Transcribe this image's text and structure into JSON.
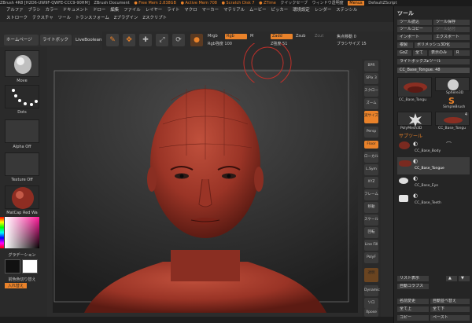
{
  "titlebar": {
    "items": [
      "ZBrush 4R8 [H2D6-UW9F-QWFE-CCC9-90HM]",
      "ZBrush Document",
      "● Free Mem 2.838GB",
      "● Active Mem 708",
      "● Scratch Disk 7",
      "● ZTime",
      "クイックセーブ",
      "ウィンドウ透明度",
      "Menus",
      "DefaultZScript"
    ],
    "highlight": "Menus"
  },
  "menubar": {
    "row1": [
      "アルファ",
      "ブラシ",
      "カラー",
      "ドキュメント",
      "ドロー",
      "編集",
      "ファイル",
      "レイヤー",
      "ライト",
      "マクロ",
      "マーカー",
      "マテリアル",
      "ムービー",
      "ピッカー",
      "環境設定",
      "レンダー",
      "ステンシル"
    ],
    "row2": [
      "ストローク",
      "テクスチャ",
      "ツール",
      "トランスフォーム",
      "Zプラグイン",
      "Zスクリプト"
    ]
  },
  "lefthead": {
    "home": "ホームページ",
    "lightbox": "ライトボックス",
    "live": "LiveBoolean"
  },
  "toolbar": {
    "mrgb": "Mrgb",
    "rgb": "Rgb",
    "m": "M",
    "zadd": "Zadd",
    "zsub": "Zsub",
    "zcut": "Zcut",
    "rgb_intensity": "Rgb強度 100",
    "z_intensity": "Z強度 51",
    "focal": "焦点移動 0",
    "draw_size": "ブラシサイズ 15"
  },
  "leftpanel": {
    "brush": "Move",
    "stroke": "Dots",
    "alpha": "Alpha Off",
    "texture": "Texture Off",
    "material": "MatCap Red Wa",
    "gradient": "グラデーション",
    "switch_color": "前色色切り替え",
    "alternate": "入れ替え"
  },
  "rightstrip": {
    "buttons": [
      "BPR",
      "SPix 3",
      "スクロール",
      "ズーム",
      "実サイズ",
      "Persp",
      "Floor",
      "ローカル",
      "L.Sym",
      "XYZ",
      "フレーム",
      "移動",
      "スケール",
      "回転",
      "Line Fill",
      "PolyF",
      "透明",
      "Dynamic",
      "ソロ",
      "Xpose"
    ],
    "spix": "SPix 3"
  },
  "toolpanel": {
    "title": "ツール",
    "buttons": [
      [
        "ツール読込",
        "ツール保存"
      ],
      [
        "ツールコピー",
        "ツール貼付"
      ],
      [
        "インポート",
        "エクスポート"
      ],
      [
        "複製",
        "ポリメッシュ3D化"
      ],
      [
        "GoZ",
        "全て",
        "表示のみ",
        "R"
      ]
    ],
    "lightbox_tools": "ライトボックス▸ツール",
    "current": "CC_Base_Tongue. 48",
    "thumbs": [
      {
        "label": "CC_Base_Tongu",
        "count": ""
      },
      {
        "label": "Sphere3D",
        "count": ""
      },
      {
        "label": "SimpleBrush",
        "count": ""
      },
      {
        "label": "PolyMesh3D",
        "count": ""
      },
      {
        "label": "CC_Base_Tongu",
        "count": "4"
      }
    ],
    "subtool_header": "サブツール",
    "subtools": [
      "CC_Base_Body",
      "CC_Base_Tongue",
      "CC_Base_Eye",
      "CC_Base_Teeth"
    ],
    "bottom_buttons": [
      [
        "リスト表示",
        "▲",
        "▼"
      ],
      [
        "自動コラプス",
        "",
        ""
      ],
      [
        "名前変更",
        "自動並べ替え"
      ],
      [
        "全て上",
        "全て下"
      ],
      [
        "コピー",
        "ペースト"
      ]
    ]
  },
  "colors": {
    "accent": "#e9822a",
    "panel": "#252525",
    "skin": "#a23a2a"
  }
}
